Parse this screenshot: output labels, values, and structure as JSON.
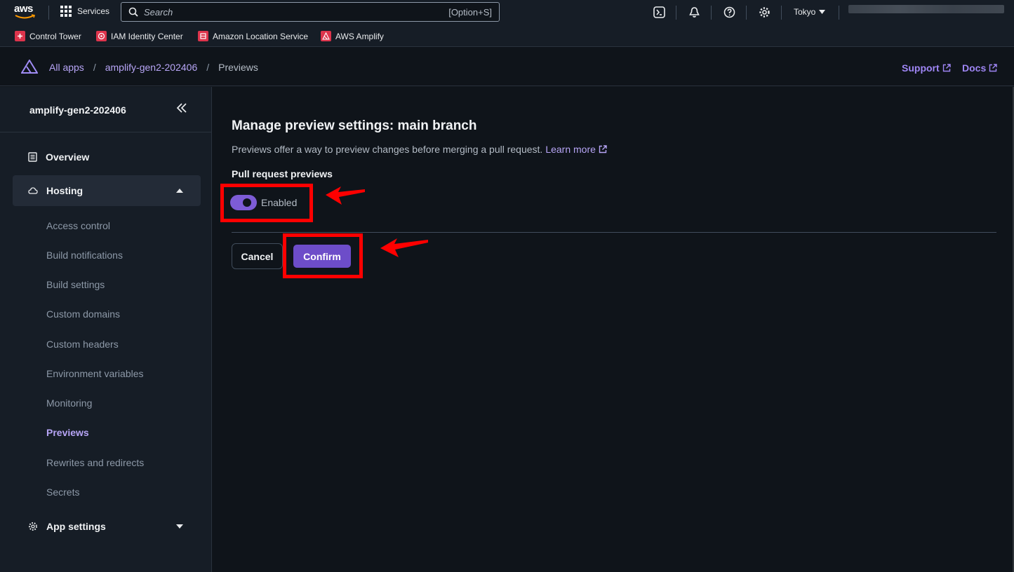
{
  "topnav": {
    "logo_text": "aws",
    "services_label": "Services",
    "search_placeholder": "Search",
    "search_shortcut": "[Option+S]",
    "region_label": "Tokyo"
  },
  "favorites": [
    {
      "label": "Control Tower",
      "icon": "control-tower-icon"
    },
    {
      "label": "IAM Identity Center",
      "icon": "iam-icon"
    },
    {
      "label": "Amazon Location Service",
      "icon": "location-icon"
    },
    {
      "label": "AWS Amplify",
      "icon": "amplify-icon"
    }
  ],
  "app_header": {
    "breadcrumbs": [
      {
        "label": "All apps"
      },
      {
        "label": "amplify-gen2-202406"
      },
      {
        "label": "Previews"
      }
    ],
    "support_label": "Support",
    "docs_label": "Docs"
  },
  "sidebar": {
    "app_name": "amplify-gen2-202406",
    "overview_label": "Overview",
    "hosting_label": "Hosting",
    "hosting_items": [
      {
        "label": "Access control"
      },
      {
        "label": "Build notifications"
      },
      {
        "label": "Build settings"
      },
      {
        "label": "Custom domains"
      },
      {
        "label": "Custom headers"
      },
      {
        "label": "Environment variables"
      },
      {
        "label": "Monitoring"
      },
      {
        "label": "Previews"
      },
      {
        "label": "Rewrites and redirects"
      },
      {
        "label": "Secrets"
      }
    ],
    "current_item": "Previews",
    "app_settings_label": "App settings"
  },
  "main": {
    "title": "Manage preview settings: main branch",
    "description": "Previews offer a way to preview changes before merging a pull request.",
    "learn_more_label": "Learn more",
    "pr_previews_label": "Pull request previews",
    "toggle_label": "Enabled",
    "toggle_on": true,
    "cancel_label": "Cancel",
    "confirm_label": "Confirm"
  },
  "colors": {
    "accent": "#6d4dc9",
    "link": "#b7a5f6",
    "annotation": "#ff0000"
  }
}
